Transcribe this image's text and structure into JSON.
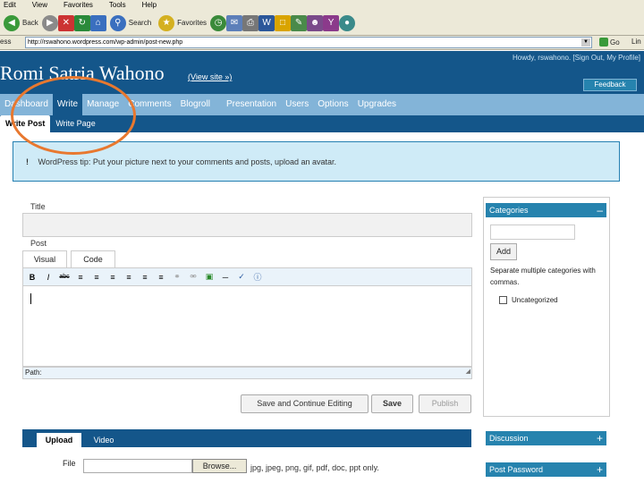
{
  "browser": {
    "menu": [
      "Edit",
      "View",
      "Favorites",
      "Tools",
      "Help"
    ],
    "toolbar": {
      "back": "Back",
      "search": "Search",
      "favorites": "Favorites"
    },
    "address_label": "ess",
    "url": "http://rswahono.wordpress.com/wp-admin/post-new.php",
    "go": "Go",
    "links": "Lin"
  },
  "header": {
    "site_title": "Romi Satria Wahono",
    "view_site": "(View site »)",
    "howdy": "Howdy, rswahono. [Sign Out, My Profile]",
    "feedback": "Feedback"
  },
  "admin_menu": [
    {
      "label": "Dashboard",
      "active": false
    },
    {
      "label": "Write",
      "active": true
    },
    {
      "label": "Manage",
      "active": false
    },
    {
      "label": "Comments",
      "active": false
    },
    {
      "label": "Blogroll",
      "active": false
    },
    {
      "label": "Presentation",
      "active": false
    },
    {
      "label": "Users",
      "active": false
    },
    {
      "label": "Options",
      "active": false
    },
    {
      "label": "Upgrades",
      "active": false
    }
  ],
  "sub_menu": [
    {
      "label": "Write Post",
      "active": true
    },
    {
      "label": "Write Page",
      "active": false
    }
  ],
  "tip": {
    "mark": "!",
    "text": "WordPress tip: Put your picture next to your comments and posts, upload an avatar."
  },
  "editor": {
    "title_label": "Title",
    "post_label": "Post",
    "tabs": [
      "Visual",
      "Code"
    ],
    "path_label": "Path:"
  },
  "buttons": {
    "save_continue": "Save and Continue Editing",
    "save": "Save",
    "publish": "Publish"
  },
  "upload": {
    "tabs": [
      "Upload",
      "Video"
    ],
    "file_label": "File",
    "browse": "Browse...",
    "hint": "jpg, jpeg, png, gif, pdf, doc, ppt only."
  },
  "sidebar": {
    "categories_title": "Categories",
    "add_button": "Add",
    "separate_hint": "Separate multiple categories with commas.",
    "category_item": "Uncategorized",
    "discussion_title": "Discussion",
    "password_title": "Post Password"
  },
  "colors": {
    "header_blue": "#14568a",
    "menu_light": "#83b4d8",
    "annotation": "#e8782f"
  }
}
